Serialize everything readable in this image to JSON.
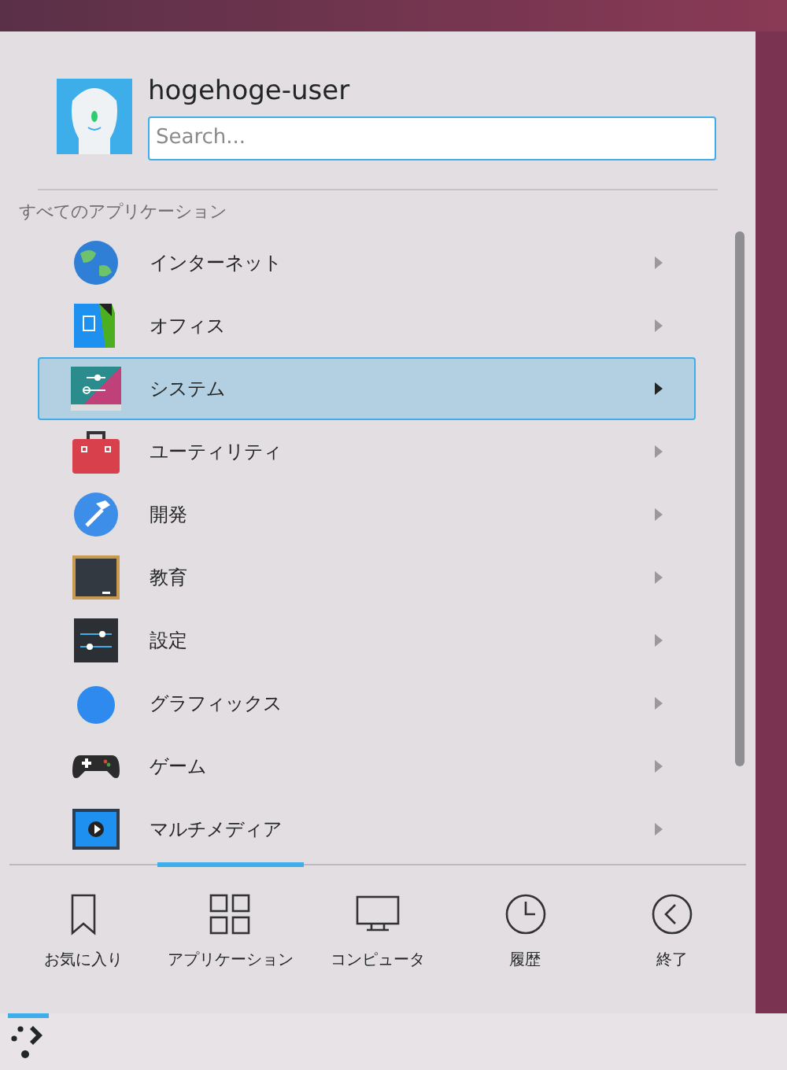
{
  "user": {
    "name": "hogehoge-user"
  },
  "search": {
    "placeholder": "Search..."
  },
  "section_title": "すべてのアプリケーション",
  "categories": [
    {
      "label": "インターネット",
      "selected": false
    },
    {
      "label": "オフィス",
      "selected": false
    },
    {
      "label": "システム",
      "selected": true
    },
    {
      "label": "ユーティリティ",
      "selected": false
    },
    {
      "label": "開発",
      "selected": false
    },
    {
      "label": "教育",
      "selected": false
    },
    {
      "label": "設定",
      "selected": false
    },
    {
      "label": "グラフィックス",
      "selected": false
    },
    {
      "label": "ゲーム",
      "selected": false
    },
    {
      "label": "マルチメディア",
      "selected": false
    }
  ],
  "tabs": [
    {
      "label": "お気に入り",
      "selected": false
    },
    {
      "label": "アプリケーション",
      "selected": true
    },
    {
      "label": "コンピュータ",
      "selected": false
    },
    {
      "label": "履歴",
      "selected": false
    },
    {
      "label": "終了",
      "selected": false
    }
  ]
}
